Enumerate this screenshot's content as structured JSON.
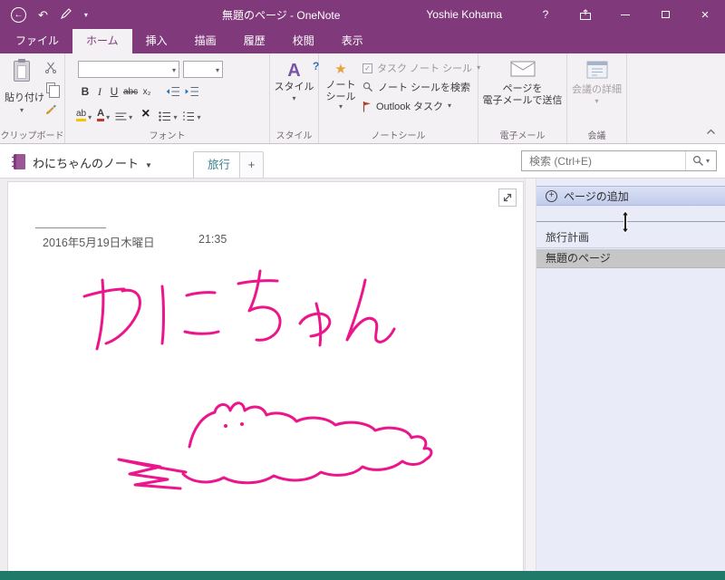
{
  "colors": {
    "titlebar": "#80397B",
    "ribbon_bg": "#F4F1F4",
    "status_bar": "#1F7A6A",
    "sidebar_bg": "#E9ECF8",
    "selected_page": "#C6C6C6",
    "section": "#39808E",
    "ink": "#EC168C"
  },
  "titlebar": {
    "title": "無題のページ - OneNote",
    "user": "Yoshie Kohama"
  },
  "tabs": [
    {
      "label": "ファイル"
    },
    {
      "label": "ホーム",
      "active": true
    },
    {
      "label": "挿入"
    },
    {
      "label": "描画"
    },
    {
      "label": "履歴"
    },
    {
      "label": "校閲"
    },
    {
      "label": "表示"
    }
  ],
  "ribbon": {
    "clipboard": {
      "paste": "貼り付け",
      "label": "クリップボード"
    },
    "font": {
      "bold": "B",
      "italic": "I",
      "underline": "U",
      "strike": "abc",
      "subscript": "x₂",
      "highlight": "ab",
      "color": "A",
      "clear": "×",
      "label": "フォント"
    },
    "styles": {
      "icon": "A",
      "button": "スタイル",
      "label": "スタイル"
    },
    "tags": {
      "big_line1": "ノート",
      "big_line2": "シール",
      "task": "タスク ノート シール",
      "find": "ノート シールを検索",
      "outlook": "Outlook タスク",
      "label": "ノートシール"
    },
    "email": {
      "line1": "ページを",
      "line2": "電子メールで送信",
      "label": "電子メール"
    },
    "meeting": {
      "button": "会議の詳細",
      "label": "会議"
    }
  },
  "navbar": {
    "notebook": "わにちゃんのノート",
    "section": "旅行",
    "search_placeholder": "検索 (Ctrl+E)"
  },
  "page": {
    "date": "2016年5月19日木曜日",
    "time": "21:35"
  },
  "sidebar": {
    "add_page": "ページの追加",
    "pages": [
      {
        "title": "旅行計画"
      },
      {
        "title": "無題のページ",
        "selected": true
      }
    ]
  },
  "icons": {
    "back": "←",
    "undo": "↶",
    "dropdown": "▾",
    "help": "?",
    "close": "×",
    "plus": "+",
    "star": "★",
    "question": "?",
    "check": "✓"
  }
}
